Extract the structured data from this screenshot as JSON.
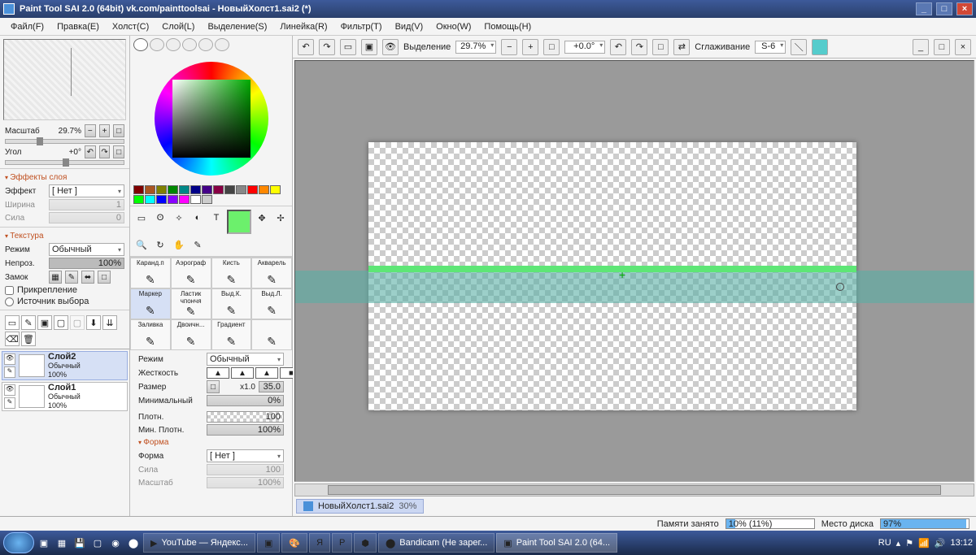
{
  "title": "Paint Tool SAI 2.0 (64bit) vk.com/painttoolsai - НовыйХолст1.sai2 (*)",
  "menu": [
    "Файл(F)",
    "Правка(E)",
    "Холст(C)",
    "Слой(L)",
    "Выделение(S)",
    "Линейка(R)",
    "Фильтр(T)",
    "Вид(V)",
    "Окно(W)",
    "Помощь(H)"
  ],
  "nav": {
    "scale_label": "Масштаб",
    "scale_value": "29.7%",
    "angle_label": "Угол",
    "angle_value": "+0°"
  },
  "fx": {
    "title": "Эффекты слоя",
    "effect_label": "Эффект",
    "effect_value": "[ Нет ]",
    "width_label": "Ширина",
    "width_value": "1",
    "strength_label": "Сила",
    "strength_value": "0"
  },
  "tex": {
    "title": "Текстура",
    "mode_label": "Режим",
    "mode_value": "Обычный",
    "opacity_label": "Непроз.",
    "opacity_value": "100%",
    "lock_label": "Замок",
    "pin_label": "Прикрепление",
    "src_label": "Источник выбора"
  },
  "layers": [
    {
      "name": "Слой2",
      "mode": "Обычный",
      "opacity": "100%",
      "selected": true
    },
    {
      "name": "Слой1",
      "mode": "Обычный",
      "opacity": "100%",
      "selected": false
    }
  ],
  "swatch_colors": [
    "#800000",
    "#a52",
    "#808000",
    "#080",
    "#088",
    "#008",
    "#408",
    "#804",
    "#444",
    "#888",
    "#f00",
    "#f80",
    "#ff0",
    "#0f0",
    "#0ff",
    "#00f",
    "#80f",
    "#f0f",
    "#fff",
    "#ccc"
  ],
  "brushes": [
    {
      "label": "Каранд.п",
      "sel": false
    },
    {
      "label": "Аэрограф",
      "sel": false
    },
    {
      "label": "Кисть",
      "sel": false
    },
    {
      "label": "Акварель",
      "sel": false
    },
    {
      "label": "Маркер",
      "sel": true
    },
    {
      "label": "Ластик чпончя",
      "sel": false
    },
    {
      "label": "Выд.К.",
      "sel": false
    },
    {
      "label": "Выд.Л.",
      "sel": false
    },
    {
      "label": "Заливка",
      "sel": false
    },
    {
      "label": "Двоичн...",
      "sel": false
    },
    {
      "label": "Градиент",
      "sel": false
    },
    {
      "label": "",
      "sel": false
    }
  ],
  "bp": {
    "mode_label": "Режим",
    "mode_value": "Обычный",
    "hard_label": "Жесткость",
    "size_label": "Размер",
    "size_mult": "x1.0",
    "size_value": "35.0",
    "min_label": "Минимальный",
    "min_value": "0%",
    "dens_label": "Плотн.",
    "dens_value": "100",
    "mindens_label": "Мин. Плотн.",
    "mindens_value": "100%",
    "shape_title": "Форма",
    "shape_label": "Форма",
    "shape_value": "[ Нет ]",
    "str_label": "Сила",
    "str_value": "100",
    "msc_label": "Масштаб",
    "msc_value": "100%"
  },
  "tb": {
    "sel": "Выделение",
    "zoom": "29.7%",
    "rot": "+0.0°",
    "smooth_label": "Сглаживание",
    "smooth_value": "S-6"
  },
  "doc": {
    "name": "НовыйХолст1.sai2",
    "zoom": "30%"
  },
  "status": {
    "mem_label": "Памяти занято",
    "mem_value": "10% (11%)",
    "mem_fill": 10,
    "disk_label": "Место диска",
    "disk_value": "97%",
    "disk_fill": 97
  },
  "taskbar": {
    "items": [
      "YouTube — Яндекс...",
      "",
      "",
      "",
      "",
      "",
      "Bandicam (Не зарег...",
      "Paint Tool SAI 2.0 (64..."
    ],
    "lang": "RU",
    "time": "13:12"
  }
}
